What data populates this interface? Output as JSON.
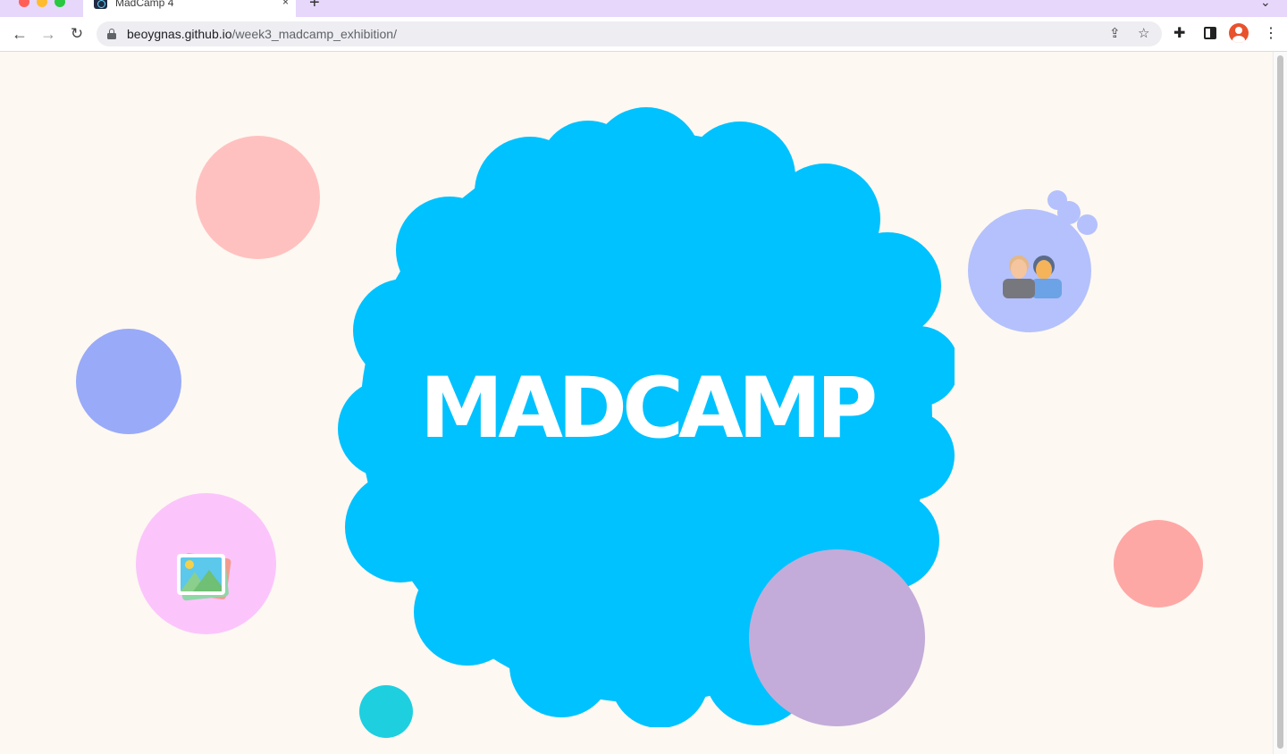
{
  "browser": {
    "tab_title": "MadCamp 4",
    "tab_close": "×",
    "new_tab": "+",
    "tab_search": "⌄",
    "url_domain": "beoygnas.github.io",
    "url_path": "/week3_madcamp_exhibition/"
  },
  "page": {
    "title": "MADCAMP"
  },
  "colors": {
    "background": "#fdf8f2",
    "main_blob": "#00c2ff",
    "pink_bubble": "#ffc1bf",
    "blue_bubble": "#99aaf9",
    "lavender_bubble": "#b4c1fc",
    "magenta_bubble": "#fbc5fc",
    "purple_bubble": "#c3acd9",
    "coral_bubble": "#fea8a6",
    "teal_bubble": "#1ecfe0"
  },
  "icons": {
    "people": "people-icon",
    "image": "image-icon"
  }
}
